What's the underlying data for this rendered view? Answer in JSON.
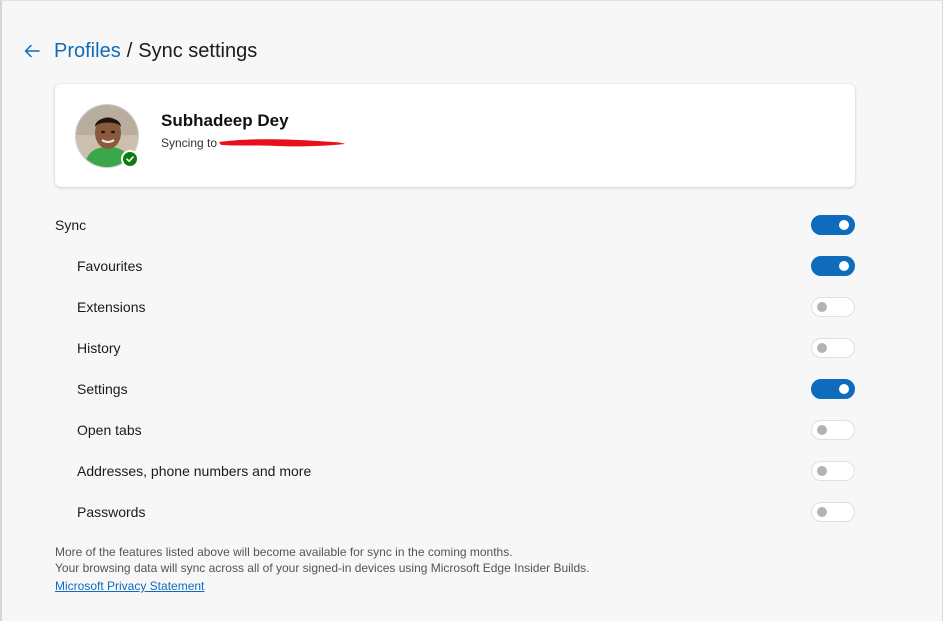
{
  "breadcrumb": {
    "parent": "Profiles",
    "separator": "/",
    "current": "Sync settings"
  },
  "profile": {
    "name": "Subhadeep Dey",
    "status_prefix": "Syncing to",
    "status_icon": "check-icon"
  },
  "sync": {
    "items": [
      {
        "label": "Sync",
        "on": true,
        "level": 0
      },
      {
        "label": "Favourites",
        "on": true,
        "level": 1
      },
      {
        "label": "Extensions",
        "on": false,
        "level": 1
      },
      {
        "label": "History",
        "on": false,
        "level": 1
      },
      {
        "label": "Settings",
        "on": true,
        "level": 1
      },
      {
        "label": "Open tabs",
        "on": false,
        "level": 1
      },
      {
        "label": "Addresses, phone numbers and more",
        "on": false,
        "level": 1
      },
      {
        "label": "Passwords",
        "on": false,
        "level": 1
      }
    ]
  },
  "footer": {
    "line1": "More of the features listed above will become available for sync in the coming months.",
    "line2": "Your browsing data will sync across all of your signed-in devices using Microsoft Edge Insider Builds.",
    "privacy_link": "Microsoft Privacy Statement"
  },
  "colors": {
    "accent": "#0f6cbd",
    "success": "#107c10",
    "redaction": "#e8101b"
  }
}
